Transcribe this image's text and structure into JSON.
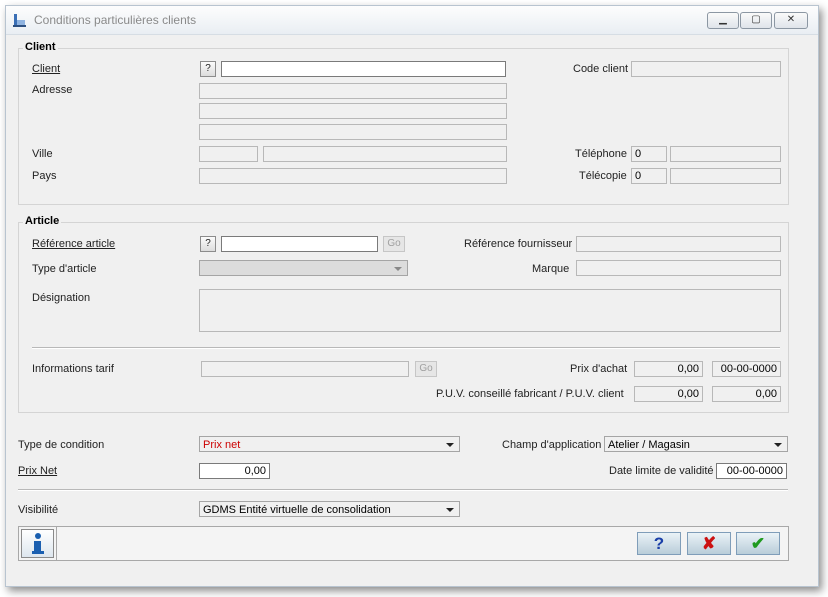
{
  "window": {
    "title": "Conditions particulières clients"
  },
  "client": {
    "group_title": "Client",
    "client_label": "Client",
    "help": "?",
    "client_value": "",
    "code_client_label": "Code client",
    "code_client_value": "",
    "adresse_label": "Adresse",
    "ville_label": "Ville",
    "pays_label": "Pays",
    "telephone_label": "Téléphone",
    "telephone_prefix": "0",
    "telecopie_label": "Télécopie",
    "telecopie_prefix": "0"
  },
  "article": {
    "group_title": "Article",
    "reference_label": "Référence article",
    "help": "?",
    "reference_value": "",
    "go": "Go",
    "ref_fournisseur_label": "Référence fournisseur",
    "type_label": "Type d'article",
    "type_value": "",
    "marque_label": "Marque",
    "designation_label": "Désignation",
    "informations_label": "Informations tarif",
    "go2": "Go",
    "prix_achat_label": "Prix d'achat",
    "prix_achat_value": "0,00",
    "prix_achat_date": "00-00-0000",
    "puv_label": "P.U.V. conseillé fabricant / P.U.V. client",
    "puv_fabricant": "0,00",
    "puv_client": "0,00"
  },
  "condition": {
    "type_label": "Type de condition",
    "type_value": "Prix net",
    "champ_label": "Champ d'application",
    "champ_value": "Atelier / Magasin",
    "prix_net_label": "Prix Net",
    "prix_net_value": "0,00",
    "date_limite_label": "Date limite de validité",
    "date_limite_value": "00-00-0000",
    "visibilite_label": "Visibilité",
    "visibilite_value": "GDMS Entité virtuelle de consolidation"
  },
  "buttons": {
    "help": "?",
    "cancel": "✘",
    "ok": "✔"
  },
  "colors": {
    "condition_value": "#cc0000",
    "help_btn": "#1a3fa8",
    "cancel_btn": "#cc1111",
    "ok_btn": "#1f9a1f"
  }
}
